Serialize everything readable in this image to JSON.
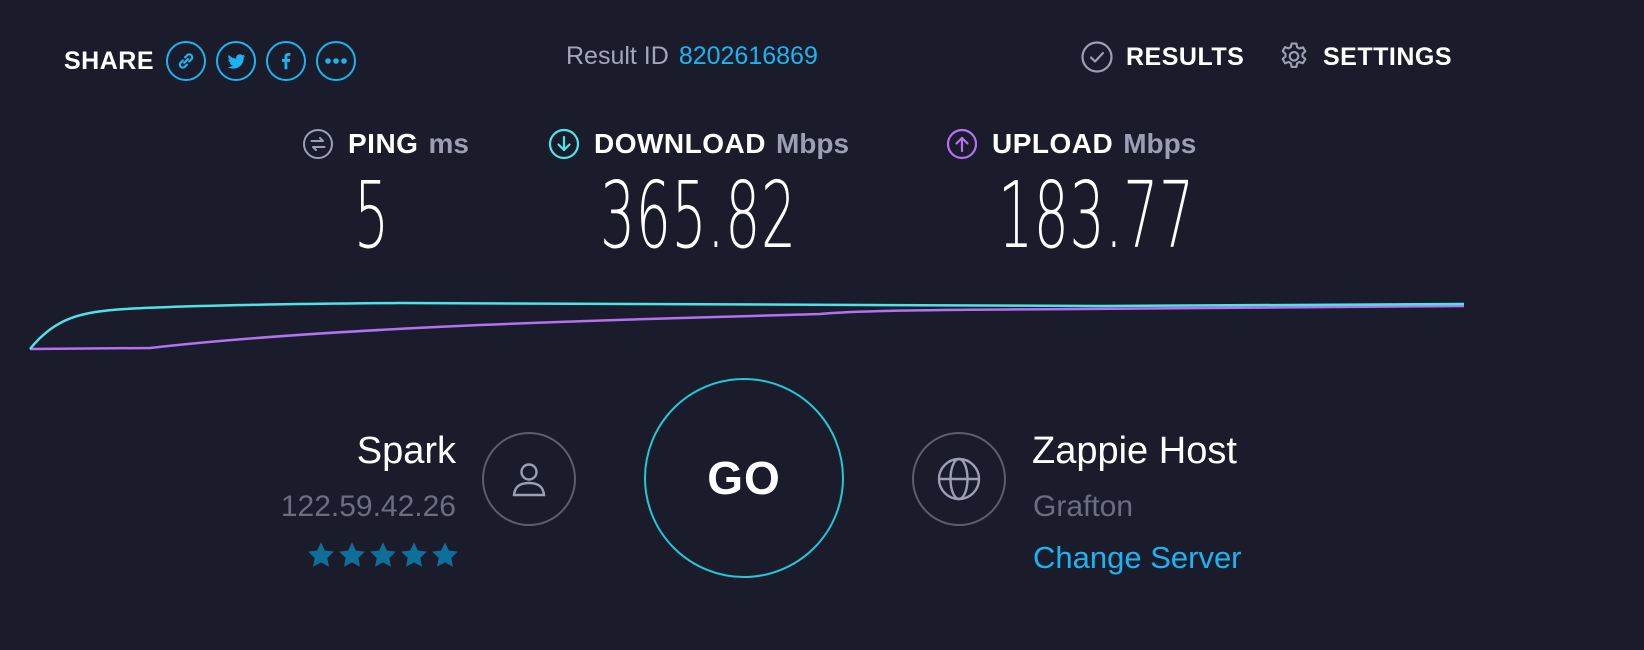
{
  "header": {
    "share_label": "SHARE",
    "share_icons": [
      "link-icon",
      "twitter-icon",
      "facebook-icon",
      "more-icon"
    ],
    "result_id_label": "Result ID",
    "result_id_value": "8202616869",
    "results_label": "RESULTS",
    "settings_label": "SETTINGS"
  },
  "metrics": {
    "ping": {
      "name": "PING",
      "unit": "ms",
      "value": "5",
      "icon": "ping-icon"
    },
    "download": {
      "name": "DOWNLOAD",
      "unit": "Mbps",
      "value": "365.82",
      "icon": "download-arrow-icon"
    },
    "upload": {
      "name": "UPLOAD",
      "unit": "Mbps",
      "value": "183.77",
      "icon": "upload-arrow-icon"
    }
  },
  "isp": {
    "name": "Spark",
    "ip": "122.59.42.26",
    "rating_stars": 5,
    "icon": "user-icon"
  },
  "go_label": "GO",
  "server": {
    "name": "Zappie Host",
    "location": "Grafton",
    "change_label": "Change Server",
    "icon": "globe-icon"
  },
  "colors": {
    "background": "#1b1c2b",
    "accent_blue": "#1cb4f0",
    "download_cyan": "#4fe3e8",
    "upload_purple": "#b372f2",
    "go_ring": "#23c7d8",
    "star": "#0e6f9a"
  }
}
